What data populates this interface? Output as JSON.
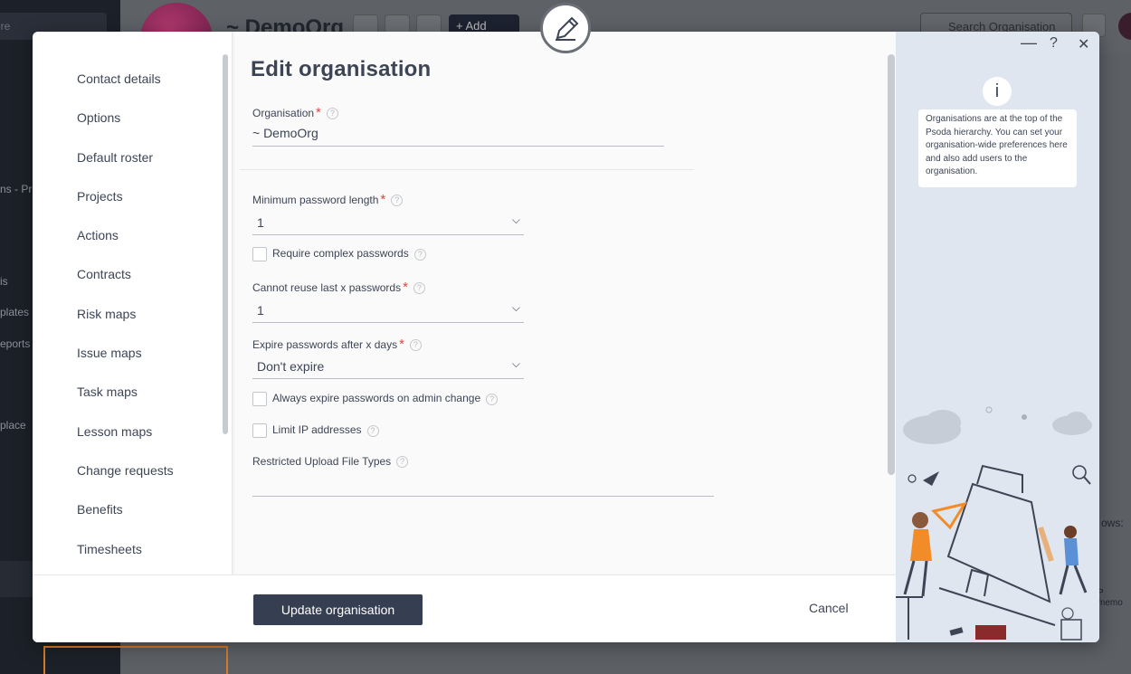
{
  "background": {
    "sidebar_search_placeholder": "ere",
    "sidebar_items": [
      "ns - Pro",
      "is",
      "plates",
      "eports &",
      "place"
    ],
    "page_title": "~ DemoOrg",
    "add_button": "+ Add",
    "search_placeholder": "Search Organisation",
    "right_text_1": "ows:",
    "right_text_2": "P memo"
  },
  "modal": {
    "title": "Edit organisation",
    "nav_items": [
      "Contact details",
      "Options",
      "Default roster",
      "Projects",
      "Actions",
      "Contracts",
      "Risk maps",
      "Issue maps",
      "Task maps",
      "Lesson maps",
      "Change requests",
      "Benefits",
      "Timesheets"
    ],
    "fields": {
      "organisation_label": "Organisation",
      "organisation_value": "~ DemoOrg",
      "min_password_label": "Minimum password length",
      "min_password_value": "1",
      "complex_passwords_label": "Require complex passwords",
      "reuse_label": "Cannot reuse last x passwords",
      "reuse_value": "1",
      "expire_label": "Expire passwords after x days",
      "expire_value": "Don't expire",
      "admin_change_label": "Always expire passwords on admin change",
      "limit_ip_label": "Limit IP addresses",
      "upload_types_label": "Restricted Upload File Types",
      "upload_types_value": ""
    },
    "footer": {
      "update_button": "Update organisation",
      "cancel_button": "Cancel"
    },
    "info": {
      "icon": "i",
      "text": "Organisations are at the top of the Psoda hierarchy. You can set your organisation-wide preferences here and also add users to the organisation."
    },
    "window_controls": {
      "minimize": "—",
      "help": "?",
      "close": "✕"
    }
  },
  "colors": {
    "primary_button": "#363e52",
    "required": "#e0453f",
    "info_panel": "#dfe6f0",
    "illustration_accent": "#f28c28"
  }
}
